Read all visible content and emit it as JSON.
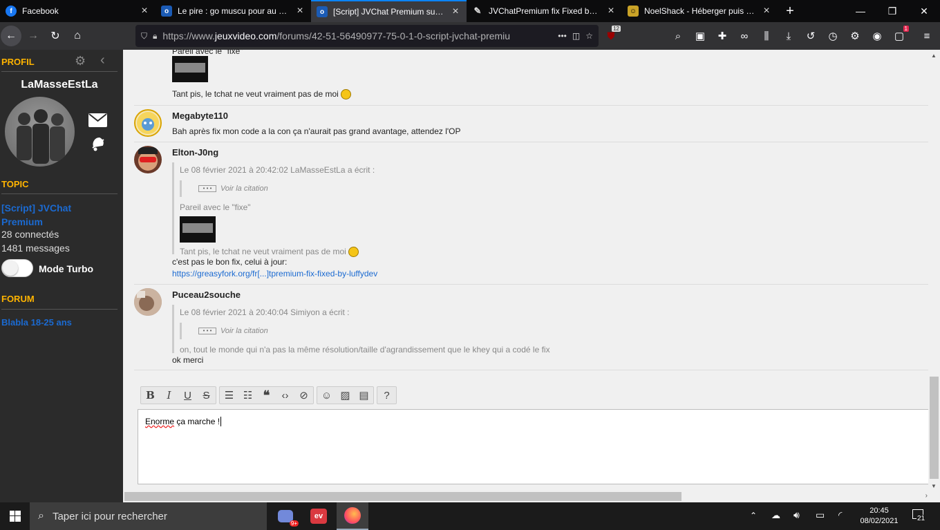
{
  "tabs": [
    {
      "title": "Facebook",
      "icon": "facebook-icon",
      "selected": false
    },
    {
      "title": "Le pire : go muscu pour au final",
      "icon": "jvc-icon",
      "selected": false
    },
    {
      "title": "[Script] JVChat Premium sur le fo",
      "icon": "jvc-icon",
      "selected": true
    },
    {
      "title": "JVChatPremium fix Fixed by Lu",
      "icon": "greasyfork-icon",
      "selected": false
    },
    {
      "title": "NoelShack - Héberger puis part",
      "icon": "noelshack-icon",
      "selected": false
    }
  ],
  "nav": {
    "url_prefix": "https://www.",
    "url_domain": "jeuxvideo.com",
    "url_path": "/forums/42-51-56490977-75-0-1-0-script-jvchat-premiu",
    "more": "•••",
    "ublock_count": "12",
    "notif_count": "1"
  },
  "sidebar": {
    "profil_heading": "PROFIL",
    "username": "LaMasseEstLa",
    "topic_heading": "TOPIC",
    "topic_title": "[Script] JVChat Premium",
    "connected": "28 connectés",
    "messages": "1481 messages",
    "turbo_label": "Mode Turbo",
    "forum_heading": "FORUM",
    "forum_name": "Blabla 18-25 ans"
  },
  "posts": {
    "p0": {
      "line1": "Pareil avec le \"fixe\"",
      "line2": "Tant pis, le tchat ne veut vraiment pas de moi"
    },
    "p1": {
      "author": "Megabyte110",
      "text": "Bah après fix mon code a la con ça n'aurait pas grand avantage, attendez l'OP"
    },
    "p2": {
      "author": "Elton-J0ng",
      "quote_header": "Le 08 février 2021 à 20:42:02 LaMasseEstLa a écrit :",
      "voir": "Voir la citation",
      "quote_line1": "Pareil avec le \"fixe\"",
      "quote_line2": "Tant pis, le tchat ne veut vraiment pas de moi",
      "text": "c'est pas le bon fix, celui à jour:",
      "link": "https://greasyfork.org/fr[...]tpremium-fix-fixed-by-luffydev"
    },
    "p3": {
      "author": "Puceau2souche",
      "quote_header": "Le 08 février 2021 à 20:40:04 Simiyon a écrit :",
      "voir": "Voir la citation",
      "quote_line1": "on, tout le monde qui n'a pas la même résolution/taille d'agrandissement que le khey qui a codé le fix",
      "text": "ok merci"
    }
  },
  "editor": {
    "word1": "Enorme",
    "rest": " ça marche !"
  },
  "taskbar": {
    "search_placeholder": "Taper ici pour rechercher",
    "time": "20:45",
    "date": "08/02/2021",
    "notif_count": "21",
    "discord_badge": "9+"
  }
}
